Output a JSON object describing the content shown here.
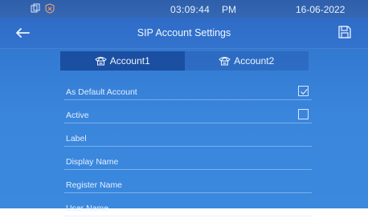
{
  "status": {
    "time": "03:09:44",
    "ampm": "PM",
    "date": "16-06-2022"
  },
  "header": {
    "title": "SIP Account Settings"
  },
  "tabs": [
    {
      "label": "Account1",
      "icon": "phone-icon",
      "active": true
    },
    {
      "label": "Account2",
      "icon": "phone-icon",
      "active": false
    }
  ],
  "fields": {
    "default_account": {
      "label": "As Default Account",
      "checked": true
    },
    "active": {
      "label": "Active",
      "checked": false
    },
    "label": {
      "label": "Label"
    },
    "display_name": {
      "label": "Display Name"
    },
    "register_name": {
      "label": "Register Name"
    },
    "user_name": {
      "label": "User Name"
    }
  },
  "colors": {
    "background": "#3a86dc",
    "statusbar": "#3567b3",
    "active_tab": "#1c4b96"
  }
}
